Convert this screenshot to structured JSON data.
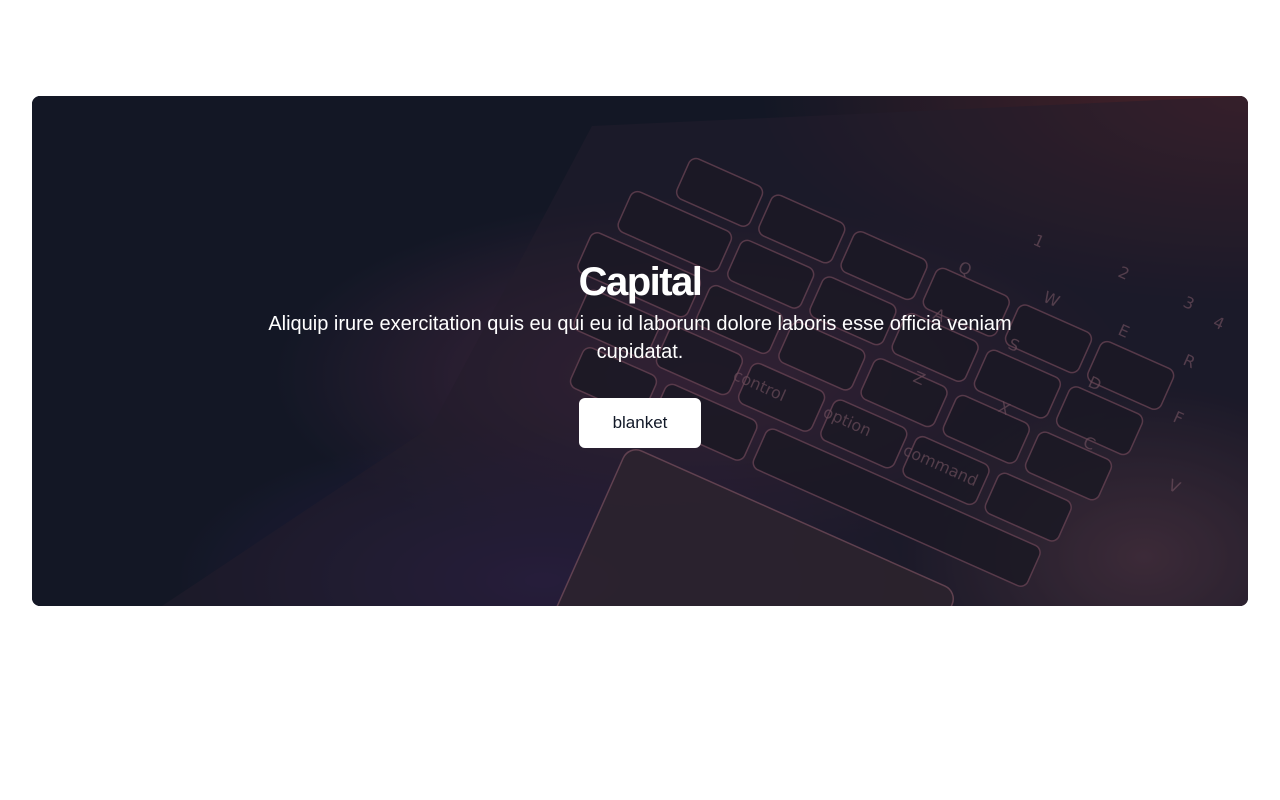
{
  "hero": {
    "title": "Capital",
    "subtitle": "Aliquip irure exercitation quis eu qui eu id laborum dolore laboris esse officia veniam cupidatat.",
    "button_label": "blanket",
    "background_image": "laptop-keyboard-photo",
    "key_labels": [
      "control",
      "option",
      "command",
      "Q",
      "W",
      "E",
      "R",
      "A",
      "S",
      "D",
      "F",
      "Z",
      "X",
      "C",
      "V",
      "1",
      "2",
      "3",
      "4"
    ]
  },
  "colors": {
    "overlay": "#131826",
    "accent_purple": "#3a2468",
    "accent_pink": "#6e3354",
    "accent_red": "#7a2c2c",
    "button_bg": "#ffffff",
    "button_text": "#111827",
    "page_bg": "#ffffff"
  }
}
